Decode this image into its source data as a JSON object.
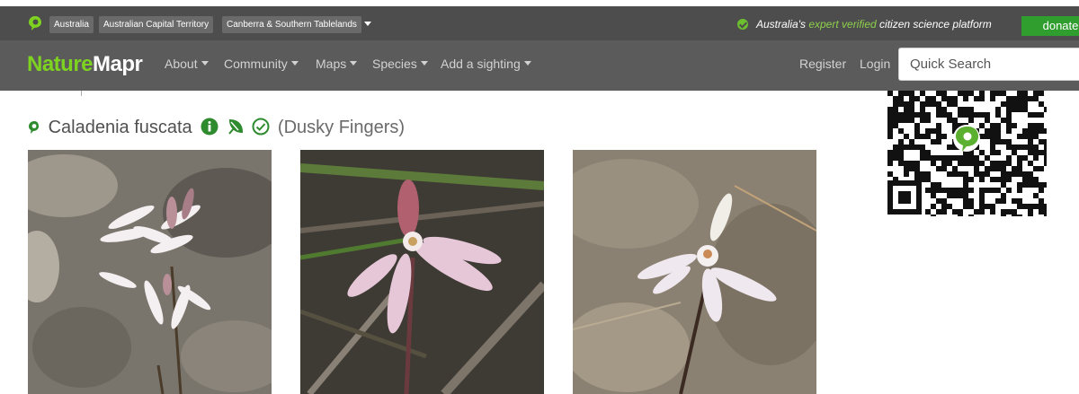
{
  "topbar": {
    "breadcrumbs": [
      "Australia",
      "Australian Capital Territory",
      "Canberra & Southern Tablelands"
    ],
    "tagline_start": "Australia's",
    "tagline_highlight": "expert verified",
    "tagline_end": "citizen science platform",
    "donate_label": "donate"
  },
  "navbar": {
    "brand_part1": "Nature",
    "brand_part2": "Mapr",
    "menu": [
      "About",
      "Community",
      "Maps",
      "Species",
      "Add a sighting"
    ],
    "register_label": "Register",
    "login_label": "Login",
    "search_placeholder": "Quick Search"
  },
  "species": {
    "scientific_name": "Caladenia fuscata",
    "common_name": "(Dusky Fingers)",
    "icons": [
      "info-icon",
      "leaf-icon",
      "verified-check-icon"
    ]
  },
  "photos": [
    "orchid-photo-1",
    "orchid-photo-2",
    "orchid-photo-3"
  ],
  "colors": {
    "brand_green": "#7ed321",
    "donate_green": "#2f9e2f",
    "topbar_bg": "#4d4d4d",
    "navbar_bg": "#5b5b5b",
    "icon_green": "#2e8b2e"
  }
}
